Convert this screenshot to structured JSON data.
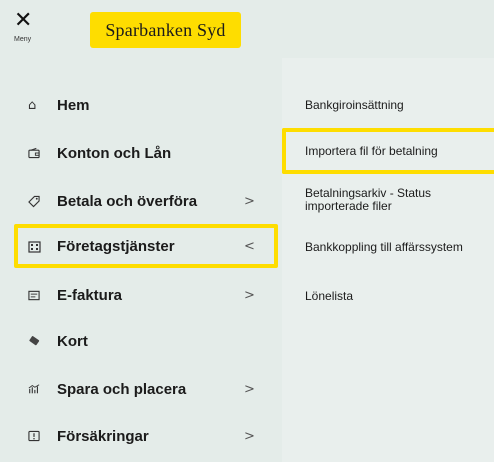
{
  "header": {
    "menu_icon": "close-icon",
    "menu_label": "Meny",
    "logo_text": "Sparbanken Syd",
    "logo_color": "#fedd00"
  },
  "nav": {
    "items": [
      {
        "label": "Hem",
        "icon": "home-icon",
        "has_chevron": false
      },
      {
        "label": "Konton och Lån",
        "icon": "wallet-icon",
        "has_chevron": false
      },
      {
        "label": "Betala och överföra",
        "icon": "tag-icon",
        "has_chevron": true,
        "chevron": ">"
      },
      {
        "label": "Företagstjänster",
        "icon": "building-icon",
        "has_chevron": true,
        "chevron": "<",
        "active": true
      },
      {
        "label": "E-faktura",
        "icon": "invoice-icon",
        "has_chevron": true,
        "chevron": ">"
      },
      {
        "label": "Kort",
        "icon": "card-icon",
        "has_chevron": false
      },
      {
        "label": "Spara och placera",
        "icon": "chart-icon",
        "has_chevron": true,
        "chevron": ">"
      },
      {
        "label": "Försäkringar",
        "icon": "shield-icon",
        "has_chevron": true,
        "chevron": ">"
      }
    ]
  },
  "submenu": {
    "items": [
      {
        "label": "Bankgiroinsättning"
      },
      {
        "label": "Importera fil för betalning",
        "active": true
      },
      {
        "label": "Betalningsarkiv - Status importerade filer"
      },
      {
        "label": "Bankkoppling till affärssystem"
      },
      {
        "label": "Lönelista"
      }
    ]
  }
}
